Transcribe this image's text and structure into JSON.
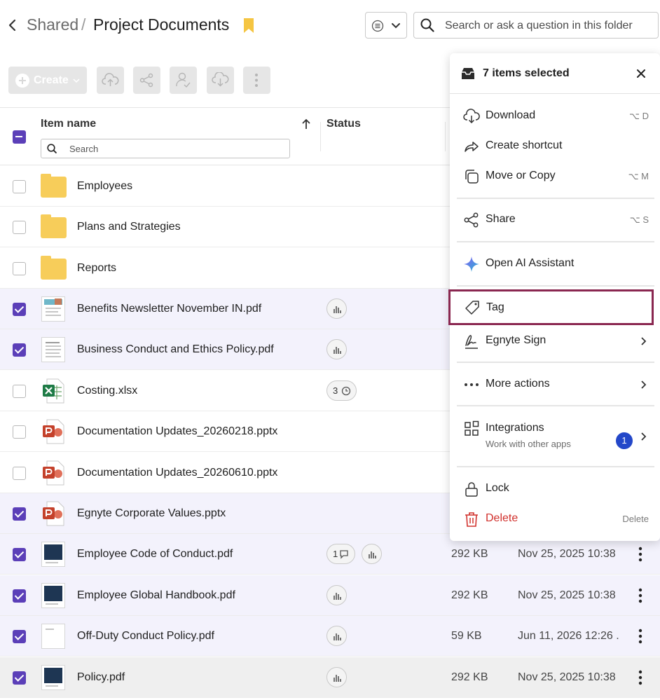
{
  "header": {
    "breadcrumb_parent": "Shared",
    "breadcrumb_sep": "/",
    "title": "Project Documents",
    "search_placeholder": "Search or ask a question in this folder"
  },
  "toolbar": {
    "create_label": "Create"
  },
  "table": {
    "columns": {
      "name": "Item name",
      "status": "Status"
    },
    "name_search_placeholder": "Search",
    "rows": [
      {
        "name": "Employees",
        "type": "folder",
        "selected": false
      },
      {
        "name": "Plans and Strategies",
        "type": "folder",
        "selected": false
      },
      {
        "name": "Reports",
        "type": "folder",
        "selected": false
      },
      {
        "name": "Benefits Newsletter November IN.pdf",
        "type": "pdf",
        "selected": true
      },
      {
        "name": "Business Conduct and Ethics Policy.pdf",
        "type": "pdf",
        "selected": true
      },
      {
        "name": "Costing.xlsx",
        "type": "xlsx",
        "selected": false,
        "versions": "3"
      },
      {
        "name": "Documentation Updates_20260218.pptx",
        "type": "pptx",
        "selected": false
      },
      {
        "name": "Documentation Updates_20260610.pptx",
        "type": "pptx",
        "selected": false
      },
      {
        "name": "Egnyte Corporate Values.pptx",
        "type": "pptx",
        "selected": true
      },
      {
        "name": "Employee Code of Conduct.pdf",
        "type": "pdf",
        "selected": true,
        "comments": "1",
        "size": "292 KB",
        "date": "Nov 25, 2025 10:38"
      },
      {
        "name": "Employee Global Handbook.pdf",
        "type": "pdf",
        "selected": true,
        "size": "292 KB",
        "date": "Nov 25, 2025 10:38"
      },
      {
        "name": "Off-Duty Conduct Policy.pdf",
        "type": "pdf",
        "selected": true,
        "size": "59 KB",
        "date": "Jun 11, 2026 12:26 ."
      },
      {
        "name": "Policy.pdf",
        "type": "pdf",
        "selected": true,
        "size": "292 KB",
        "date": "Nov 25, 2025 10:38"
      }
    ]
  },
  "menu": {
    "title": "7 items selected",
    "items": {
      "download": {
        "label": "Download",
        "shortcut": "⌥ D"
      },
      "shortcut": {
        "label": "Create shortcut"
      },
      "move": {
        "label": "Move or Copy",
        "shortcut": "⌥ M"
      },
      "share": {
        "label": "Share",
        "shortcut": "⌥ S"
      },
      "ai": {
        "label": "Open AI Assistant"
      },
      "tag": {
        "label": "Tag"
      },
      "sign": {
        "label": "Egnyte Sign"
      },
      "more": {
        "label": "More actions"
      },
      "integrations": {
        "label": "Integrations",
        "sublabel": "Work with other apps",
        "badge": "1"
      },
      "lock": {
        "label": "Lock"
      },
      "delete": {
        "label": "Delete",
        "shortcut": "Delete"
      }
    }
  },
  "colors": {
    "accent": "#5b3fb8",
    "selected_row": "#f3f2fc",
    "tag_highlight": "#8a2750",
    "delete": "#d1302c",
    "folder": "#f7cd5a",
    "badge": "#2347c9"
  }
}
